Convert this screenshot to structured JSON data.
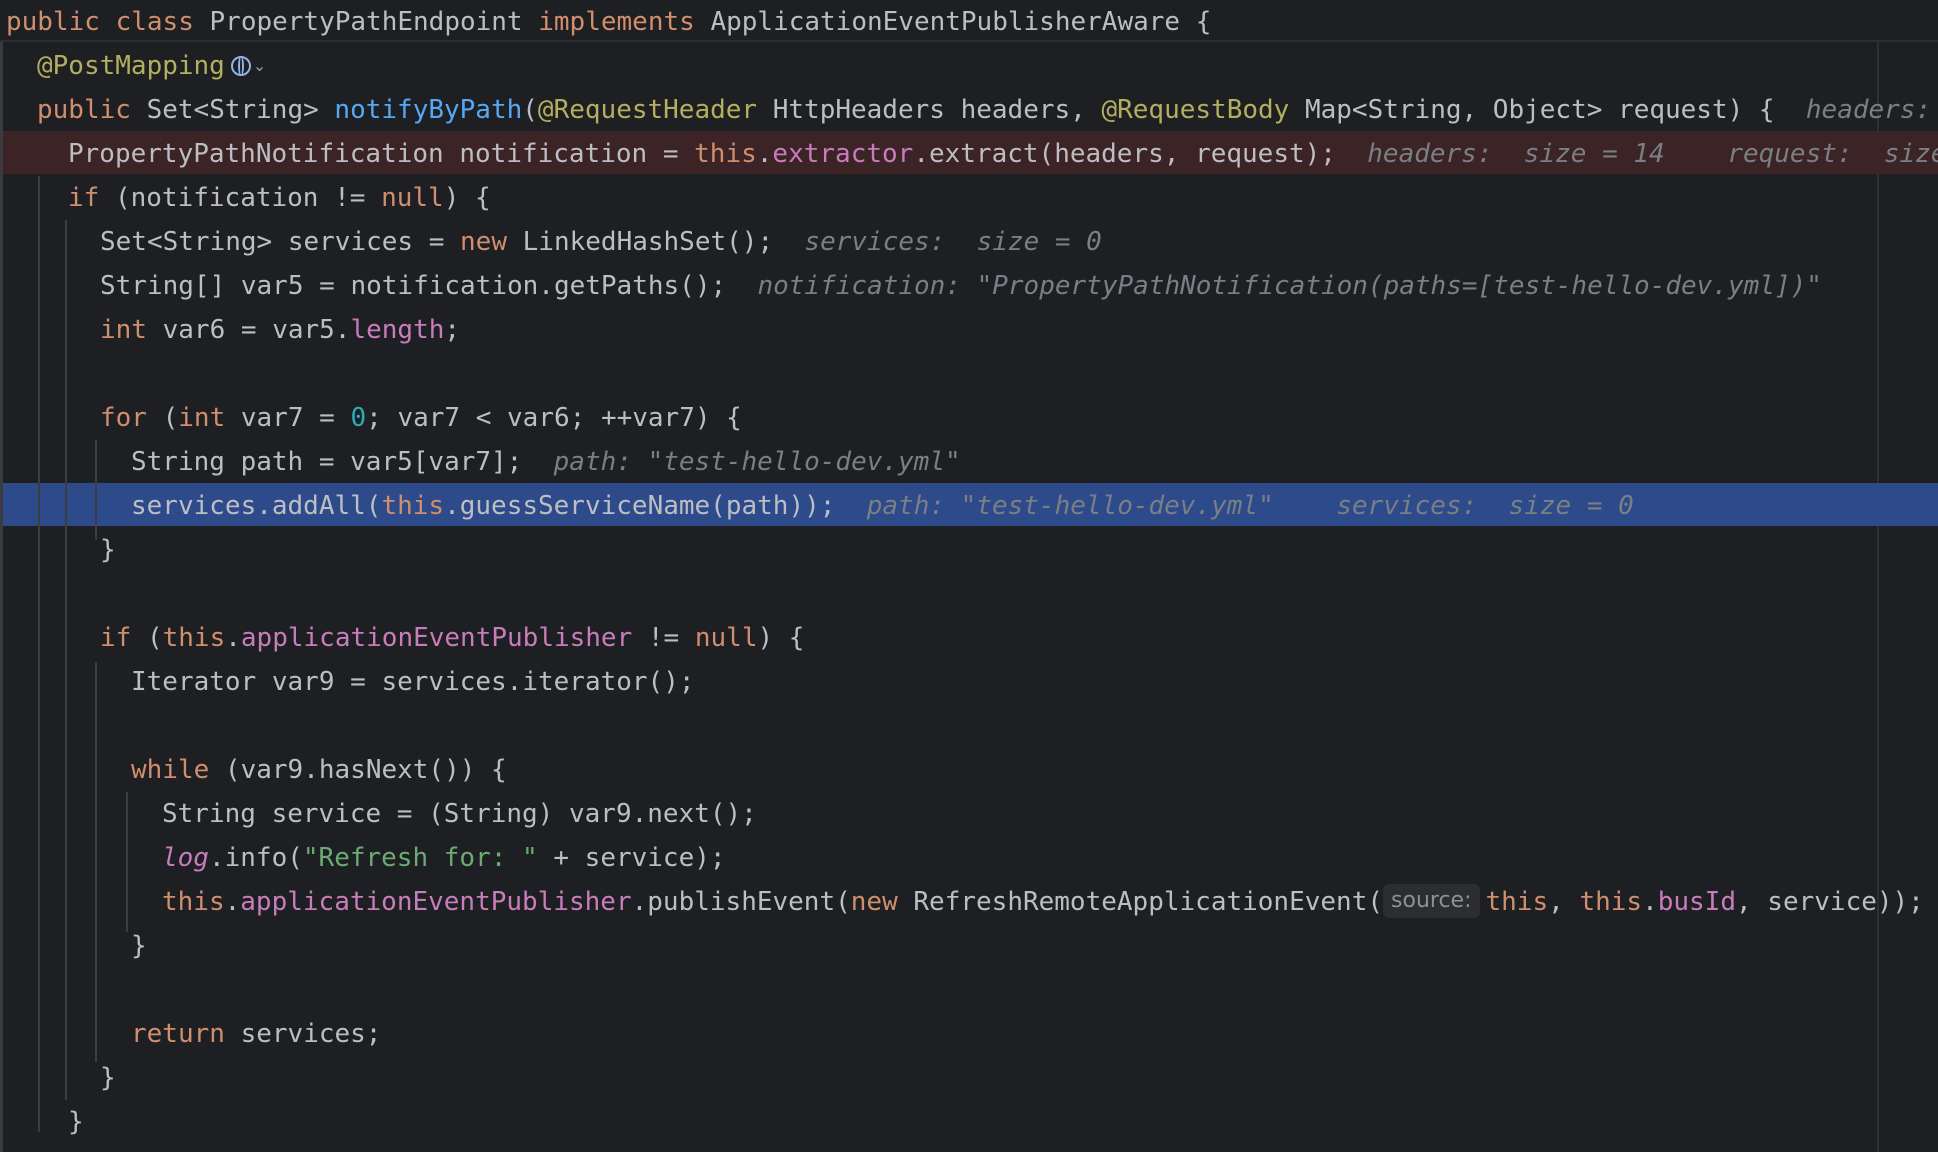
{
  "colors": {
    "background": "#1e1f22",
    "keyword": "#cf8e6d",
    "function": "#56a8f5",
    "annotation": "#b3ae60",
    "field": "#c77dbb",
    "number": "#2aacb8",
    "string": "#6aab73",
    "hint": "#7a7e85",
    "error_line_bg": "#3b2326",
    "execution_line_bg": "#2d4a8a"
  },
  "icons": {
    "endpoint": "globe-icon",
    "dropdown": "chevron-down-icon"
  },
  "code": {
    "l1": {
      "kw1": "public",
      "kw2": "class",
      "name": "PropertyPathEndpoint",
      "kw3": "implements",
      "iface": "ApplicationEventPublisherAware {"
    },
    "l2": {
      "annotation": "@PostMapping"
    },
    "l3": {
      "kw1": "public",
      "t1": "Set<String>",
      "fn": "notifyByPath",
      "t2": "(",
      "a1": "@RequestHeader",
      "t3": "HttpHeaders headers,",
      "a2": "@RequestBody",
      "t4": "Map<String, Object> request) {",
      "hint": "headers:"
    },
    "l4": {
      "t1": "PropertyPathNotification notification = ",
      "kw": "this",
      "t2": ".",
      "fld": "extractor",
      "t3": ".extract(headers, request);",
      "hint1": "headers:  size = 14",
      "hint2": "request:  size"
    },
    "l5": {
      "kw1": "if",
      "t1": " (notification != ",
      "kw2": "null",
      "t2": ") {"
    },
    "l6": {
      "t1": "Set<String> services = ",
      "kw": "new",
      "t2": " LinkedHashSet();",
      "hint": "services:  size = 0"
    },
    "l7": {
      "t1": "String[] var5 = notification.getPaths();",
      "hint": "notification: \"PropertyPathNotification(paths=[test-hello-dev.yml])\""
    },
    "l8": {
      "kw": "int",
      "t1": " var6 = var5.",
      "fld": "length",
      "t2": ";"
    },
    "l10": {
      "kw1": "for",
      "t1": " (",
      "kw2": "int",
      "t2": " var7 = ",
      "num": "0",
      "t3": "; var7 < var6; ++var7) {"
    },
    "l11": {
      "t1": "String path = var5[var7];",
      "hint": "path: \"test-hello-dev.yml\""
    },
    "l12": {
      "t1": "services.addAll(",
      "kw": "this",
      "t2": ".guessServiceName(path));",
      "hint1": "path: \"test-hello-dev.yml\"",
      "hint2": "services:  size = 0"
    },
    "l13": {
      "t1": "}"
    },
    "l15": {
      "kw1": "if",
      "t1": " (",
      "kw2": "this",
      "t2": ".",
      "fld": "applicationEventPublisher",
      "t3": " != ",
      "kw3": "null",
      "t4": ") {"
    },
    "l16": {
      "t1": "Iterator var9 = services.iterator();"
    },
    "l18": {
      "kw": "while",
      "t1": " (var9.hasNext()) {"
    },
    "l19": {
      "t1": "String service = (String) var9.next();"
    },
    "l20": {
      "stat": "log",
      "t1": ".info(",
      "str": "\"Refresh for: \"",
      "t2": " + service);"
    },
    "l21": {
      "kw1": "this",
      "t1": ".",
      "fld1": "applicationEventPublisher",
      "t2": ".publishEvent(",
      "kw2": "new",
      "t3": " RefreshRemoteApplicationEvent(",
      "param": "source:",
      "kw3": "this",
      "t4": ", ",
      "kw4": "this",
      "t5": ".",
      "fld2": "busId",
      "t6": ", service));"
    },
    "l22": {
      "t1": "}"
    },
    "l24": {
      "kw": "return",
      "t1": " services;"
    },
    "l25": {
      "t1": "}"
    },
    "l26": {
      "t1": "}"
    }
  }
}
